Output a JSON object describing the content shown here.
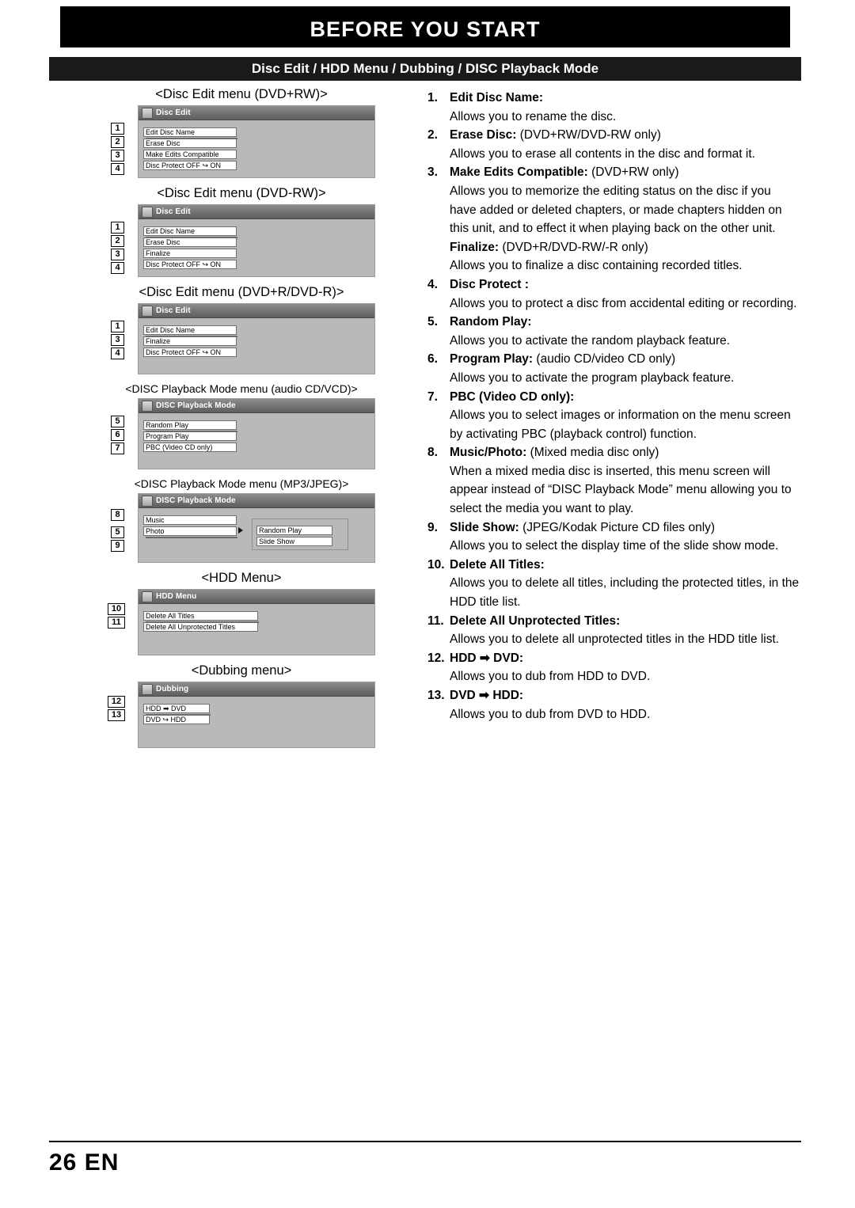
{
  "header": {
    "title": "BEFORE YOU START",
    "subtitle": "Disc Edit / HDD Menu / Dubbing / DISC Playback Mode"
  },
  "figures": [
    {
      "caption": "<Disc Edit menu (DVD+RW)>",
      "screen_title": "Disc Edit",
      "callouts": [
        "1",
        "2",
        "3",
        "4"
      ],
      "rows": [
        "Edit Disc Name",
        "Erase Disc",
        "Make Edits Compatible",
        "Disc Protect OFF ↪ ON"
      ]
    },
    {
      "caption": "<Disc Edit menu (DVD-RW)>",
      "screen_title": "Disc Edit",
      "callouts": [
        "1",
        "2",
        "3",
        "4"
      ],
      "rows": [
        "Edit Disc Name",
        "Erase Disc",
        "Finalize",
        "Disc Protect OFF ↪ ON"
      ]
    },
    {
      "caption": "<Disc Edit menu (DVD+R/DVD-R)>",
      "screen_title": "Disc Edit",
      "callouts": [
        "1",
        "3",
        "4"
      ],
      "rows": [
        "Edit Disc Name",
        "Finalize",
        "Disc Protect OFF ↪ ON"
      ]
    },
    {
      "caption": "<DISC Playback Mode menu (audio CD/VCD)>",
      "screen_title": "DISC Playback Mode",
      "callouts": [
        "5",
        "6",
        "7"
      ],
      "rows": [
        "Random Play",
        "Program Play",
        "PBC (Video CD only)"
      ]
    },
    {
      "caption": "<DISC Playback Mode menu (MP3/JPEG)>",
      "screen_title": "DISC Playback Mode",
      "callouts": [
        "8",
        "5",
        "9"
      ],
      "rows": [
        "Music",
        "Photo"
      ],
      "sub_rows": [
        "Random Play",
        "Slide Show"
      ]
    },
    {
      "caption": "<HDD Menu>",
      "screen_title": "HDD Menu",
      "callouts": [
        "10",
        "11"
      ],
      "rows": [
        "Delete All Titles",
        "Delete All Unprotected Titles"
      ]
    },
    {
      "caption": "<Dubbing menu>",
      "screen_title": "Dubbing",
      "callouts": [
        "12",
        "13"
      ],
      "rows": [
        "HDD ➡ DVD",
        "DVD ↪ HDD"
      ]
    }
  ],
  "descriptions": [
    {
      "num": "1.",
      "title": "Edit Disc Name:",
      "title_normal": "",
      "body": "Allows you to rename the disc."
    },
    {
      "num": "2.",
      "title": "Erase Disc:",
      "title_normal": " (DVD+RW/DVD-RW only)",
      "body": "Allows you to erase all contents in the disc and format it."
    },
    {
      "num": "3.",
      "title": "Make Edits Compatible:",
      "title_normal": " (DVD+RW only)",
      "body": "Allows you to memorize the editing status on the disc if you have added or deleted chapters, or made chapters hidden on this unit, and to effect it when playing back on the other unit.",
      "sub_title": "Finalize:",
      "sub_title_normal": " (DVD+R/DVD-RW/-R only)",
      "sub_body": "Allows you to finalize a disc containing recorded titles."
    },
    {
      "num": "4.",
      "title": "Disc Protect :",
      "title_normal": "",
      "body": "Allows you to protect a disc from accidental editing or recording."
    },
    {
      "num": "5.",
      "title": "Random Play:",
      "title_normal": "",
      "body": "Allows you to activate the random playback feature."
    },
    {
      "num": "6.",
      "title": "Program Play:",
      "title_normal": " (audio CD/video CD only)",
      "body": "Allows you to activate the program playback feature."
    },
    {
      "num": "7.",
      "title": "PBC (Video CD only):",
      "title_normal": "",
      "body": "Allows you to select images or information on the menu screen by activating PBC (playback control) function."
    },
    {
      "num": "8.",
      "title": "Music/Photo:",
      "title_normal": " (Mixed media disc only)",
      "body": "When a mixed media disc is inserted, this menu screen will appear instead of “DISC Playback Mode” menu allowing you to select the media you want to play."
    },
    {
      "num": "9.",
      "title": "Slide Show:",
      "title_normal": " (JPEG/Kodak Picture CD files only)",
      "body": "Allows you to select the display time of the slide show mode."
    },
    {
      "num": "10.",
      "title": "Delete All Titles:",
      "title_normal": "",
      "body": "Allows you to delete all titles, including the protected titles, in the HDD title list."
    },
    {
      "num": "11.",
      "title": "Delete All Unprotected Titles:",
      "title_normal": "",
      "body": "Allows you to delete all unprotected titles in the HDD title list."
    },
    {
      "num": "12.",
      "title": "HDD ➡ DVD:",
      "title_normal": "",
      "body": "Allows you to dub from HDD to DVD."
    },
    {
      "num": "13.",
      "title": "DVD ➡ HDD:",
      "title_normal": "",
      "body": "Allows you to dub from DVD to HDD."
    }
  ],
  "footer": {
    "page_number": "26  EN"
  }
}
